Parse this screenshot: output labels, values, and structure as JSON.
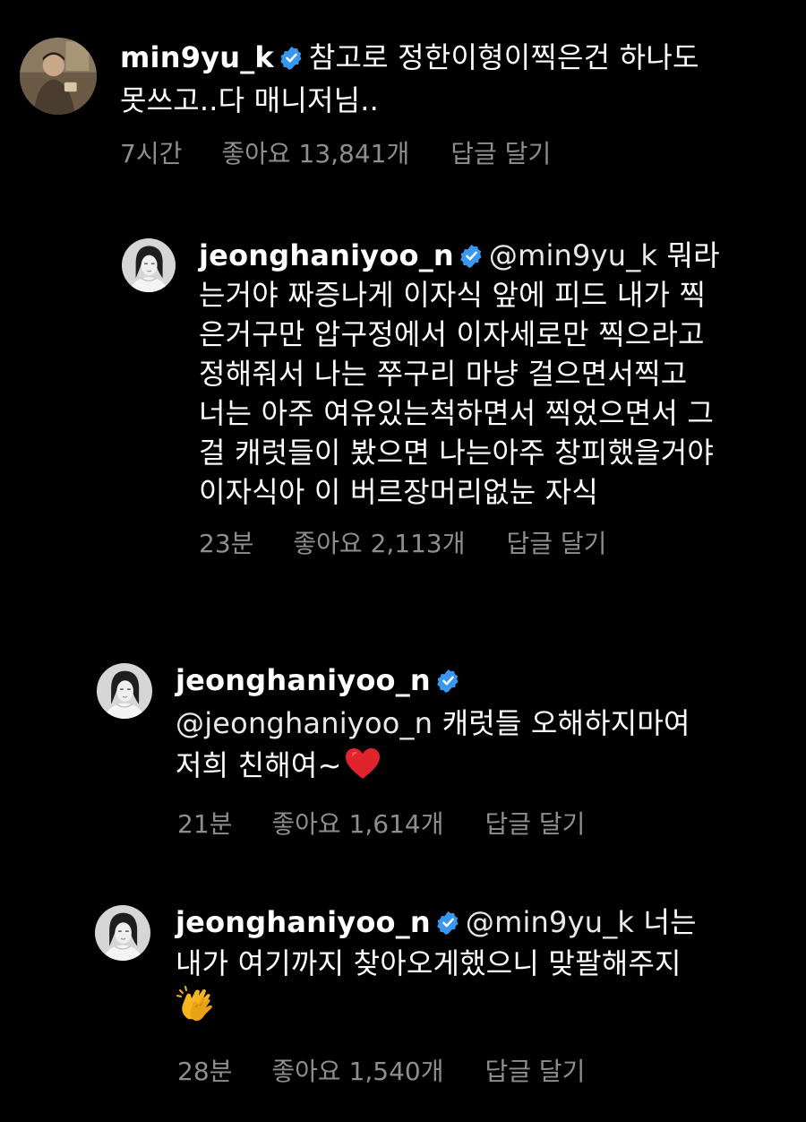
{
  "colors": {
    "background": "#000000",
    "text": "#ffffff",
    "meta": "#8e8e8e",
    "verified_badge": "#3897f0",
    "heart": "#e0242e"
  },
  "comments": [
    {
      "username": "min9yu_k",
      "verified": true,
      "lines": [
        "참고로 정한이형이찍은건 하나도",
        "못쓰고..다 매니저님.."
      ],
      "time": "7시간",
      "likes": "좋아요 13,841개",
      "reply": "답글 달기"
    },
    {
      "username": "jeonghaniyoo_n",
      "verified": true,
      "mention": "@min9yu_k",
      "lines": [
        "뭐라",
        "는거야 짜증나게 이자식 앞에 피드 내가 찍",
        "은거구만 압구정에서  이자세로만 찍으라고",
        "정해줘서 나는 쭈구리 마냥 걸으면서찍고",
        "너는 아주 여유있는척하면서 찍었으면서 그",
        "걸 캐럿들이 봤으면 나는아주 창피했을거야",
        "이자식아 이 버르장머리없눈 자식"
      ],
      "time": "23분",
      "likes": "좋아요 2,113개",
      "reply": "답글 달기"
    },
    {
      "username": "jeonghaniyoo_n",
      "verified": true,
      "mention": "@jeonghaniyoo_n",
      "lines": [
        "캐럿들 오해하지마여",
        "저희 친해여~"
      ],
      "emoji": "heart-icon",
      "time": "21분",
      "likes": "좋아요 1,614개",
      "reply": "답글 달기"
    },
    {
      "username": "jeonghaniyoo_n",
      "verified": true,
      "mention": "@min9yu_k",
      "lines": [
        "너는",
        "내가 여기까지 찾아오게했으니 맞팔해주지"
      ],
      "emoji": "clapping-hands-icon",
      "time": "28분",
      "likes": "좋아요 1,540개",
      "reply": "답글 달기"
    }
  ]
}
